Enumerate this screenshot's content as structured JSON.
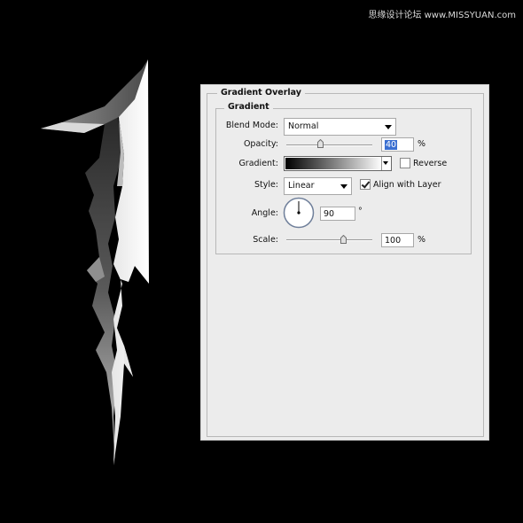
{
  "watermark": {
    "text": "思缘设计论坛 www.MISSYUAN.com"
  },
  "dialog": {
    "section_title": "Gradient Overlay",
    "group_title": "Gradient",
    "blend_mode": {
      "label": "Blend Mode:",
      "value": "Normal"
    },
    "opacity": {
      "label": "Opacity:",
      "value": "40",
      "unit": "%",
      "slider_fraction": 0.4
    },
    "gradient": {
      "label": "Gradient:",
      "stops": [
        "#000000",
        "#ffffff"
      ]
    },
    "reverse": {
      "label": "Reverse",
      "checked": false
    },
    "style": {
      "label": "Style:",
      "value": "Linear"
    },
    "align_with_layer": {
      "label": "Align with Layer",
      "checked": true
    },
    "angle": {
      "label": "Angle:",
      "value": "90",
      "unit": "°",
      "degrees": 90
    },
    "scale": {
      "label": "Scale:",
      "value": "100",
      "unit": "%",
      "slider_fraction": 0.667
    }
  }
}
